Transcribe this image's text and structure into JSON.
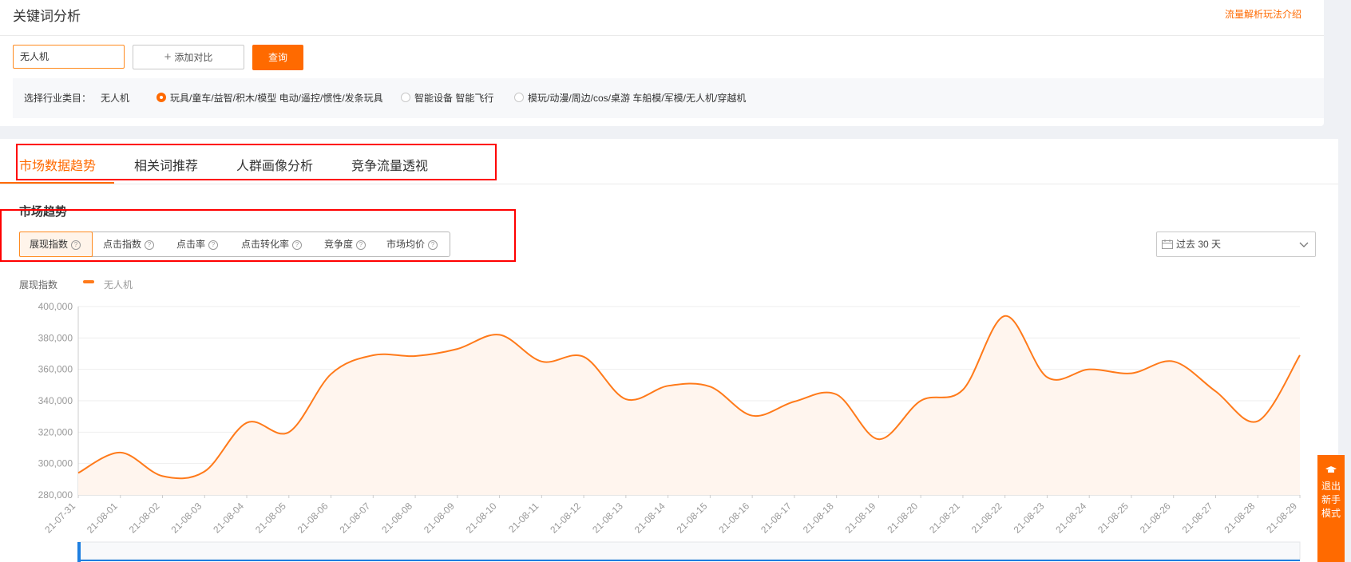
{
  "header": {
    "title": "关键词分析",
    "guide_link": "流量解析玩法介绍"
  },
  "search": {
    "keyword": "无人机",
    "add_compare": "添加对比",
    "query": "查询"
  },
  "category": {
    "label": "选择行业类目：",
    "keyword": "无人机",
    "options": [
      {
        "label": "玩具/童车/益智/积木/模型 电动/遥控/惯性/发条玩具",
        "selected": true
      },
      {
        "label": "智能设备 智能飞行",
        "selected": false
      },
      {
        "label": "模玩/动漫/周边/cos/桌游 车船模/军模/无人机/穿越机",
        "selected": false
      }
    ]
  },
  "tabs": [
    "市场数据趋势",
    "相关词推荐",
    "人群画像分析",
    "竞争流量透视"
  ],
  "section": {
    "title": "市场趋势"
  },
  "metrics": [
    "展现指数",
    "点击指数",
    "点击率",
    "点击转化率",
    "竞争度",
    "市场均价"
  ],
  "range": {
    "value": "过去 30 天"
  },
  "legend": {
    "metric": "展现指数",
    "series": "无人机"
  },
  "side_tab": {
    "lines": [
      "退出",
      "新手",
      "模式"
    ]
  },
  "colors": {
    "accent": "#ff6a00",
    "highlight": "#ff0000"
  },
  "chart_data": {
    "type": "area",
    "ylim": [
      280000,
      400000
    ],
    "y_ticks": [
      "280,000",
      "300,000",
      "320,000",
      "340,000",
      "360,000",
      "380,000",
      "400,000"
    ],
    "categories": [
      "21-07-31",
      "21-08-01",
      "21-08-02",
      "21-08-03",
      "21-08-04",
      "21-08-05",
      "21-08-06",
      "21-08-07",
      "21-08-08",
      "21-08-09",
      "21-08-10",
      "21-08-11",
      "21-08-12",
      "21-08-13",
      "21-08-14",
      "21-08-15",
      "21-08-16",
      "21-08-17",
      "21-08-18",
      "21-08-19",
      "21-08-20",
      "21-08-21",
      "21-08-22",
      "21-08-23",
      "21-08-24",
      "21-08-25",
      "21-08-26",
      "21-08-27",
      "21-08-28",
      "21-08-29"
    ],
    "series": [
      {
        "name": "无人机",
        "values": [
          294000,
          307000,
          292000,
          295000,
          326000,
          320000,
          357000,
          369000,
          368500,
          373000,
          382000,
          365000,
          368000,
          341000,
          349500,
          349000,
          330500,
          339500,
          344000,
          315500,
          340000,
          347000,
          394000,
          355000,
          360000,
          357500,
          365000,
          346000,
          327000,
          369000
        ]
      }
    ],
    "grid": true
  }
}
